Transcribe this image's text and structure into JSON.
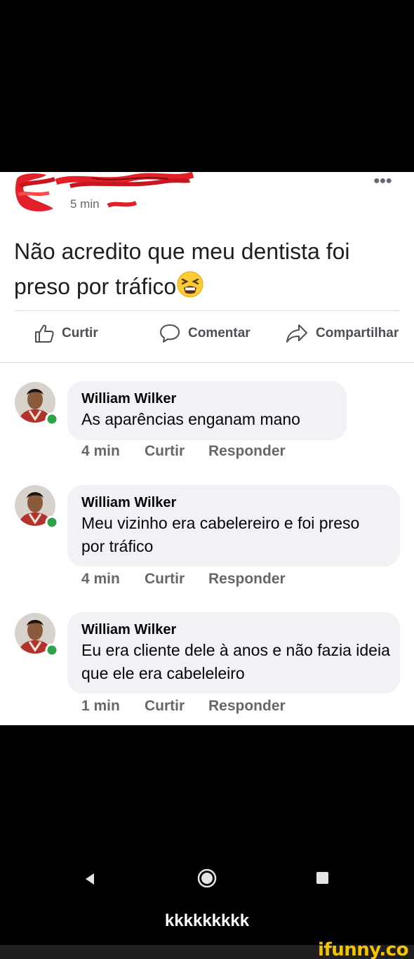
{
  "post": {
    "time": "5 min",
    "text": "Não acredito que meu dentista foi preso por tráfico",
    "more_icon": "more-dots-icon",
    "emoji": "tired-face-emoji"
  },
  "actions": {
    "like": "Curtir",
    "comment": "Comentar",
    "share": "Compartilhar"
  },
  "comments": [
    {
      "name": "William Wilker",
      "text": "As aparências enganam mano",
      "time": "4 min",
      "like": "Curtir",
      "reply": "Responder"
    },
    {
      "name": "William Wilker",
      "text": "Meu vizinho era cabelereiro e foi preso por tráfico",
      "time": "4 min",
      "like": "Curtir",
      "reply": "Responder"
    },
    {
      "name": "William Wilker",
      "text": "Eu era cliente dele à anos e não fazia ideia que ele era cabeleleiro",
      "time": "1 min",
      "like": "Curtir",
      "reply": "Responder"
    }
  ],
  "caption": "kkkkkkkkk",
  "watermark": "ifunny.co",
  "colors": {
    "online": "#31a24c",
    "scribble": "#e3202a",
    "watermark": "#f5c400"
  }
}
